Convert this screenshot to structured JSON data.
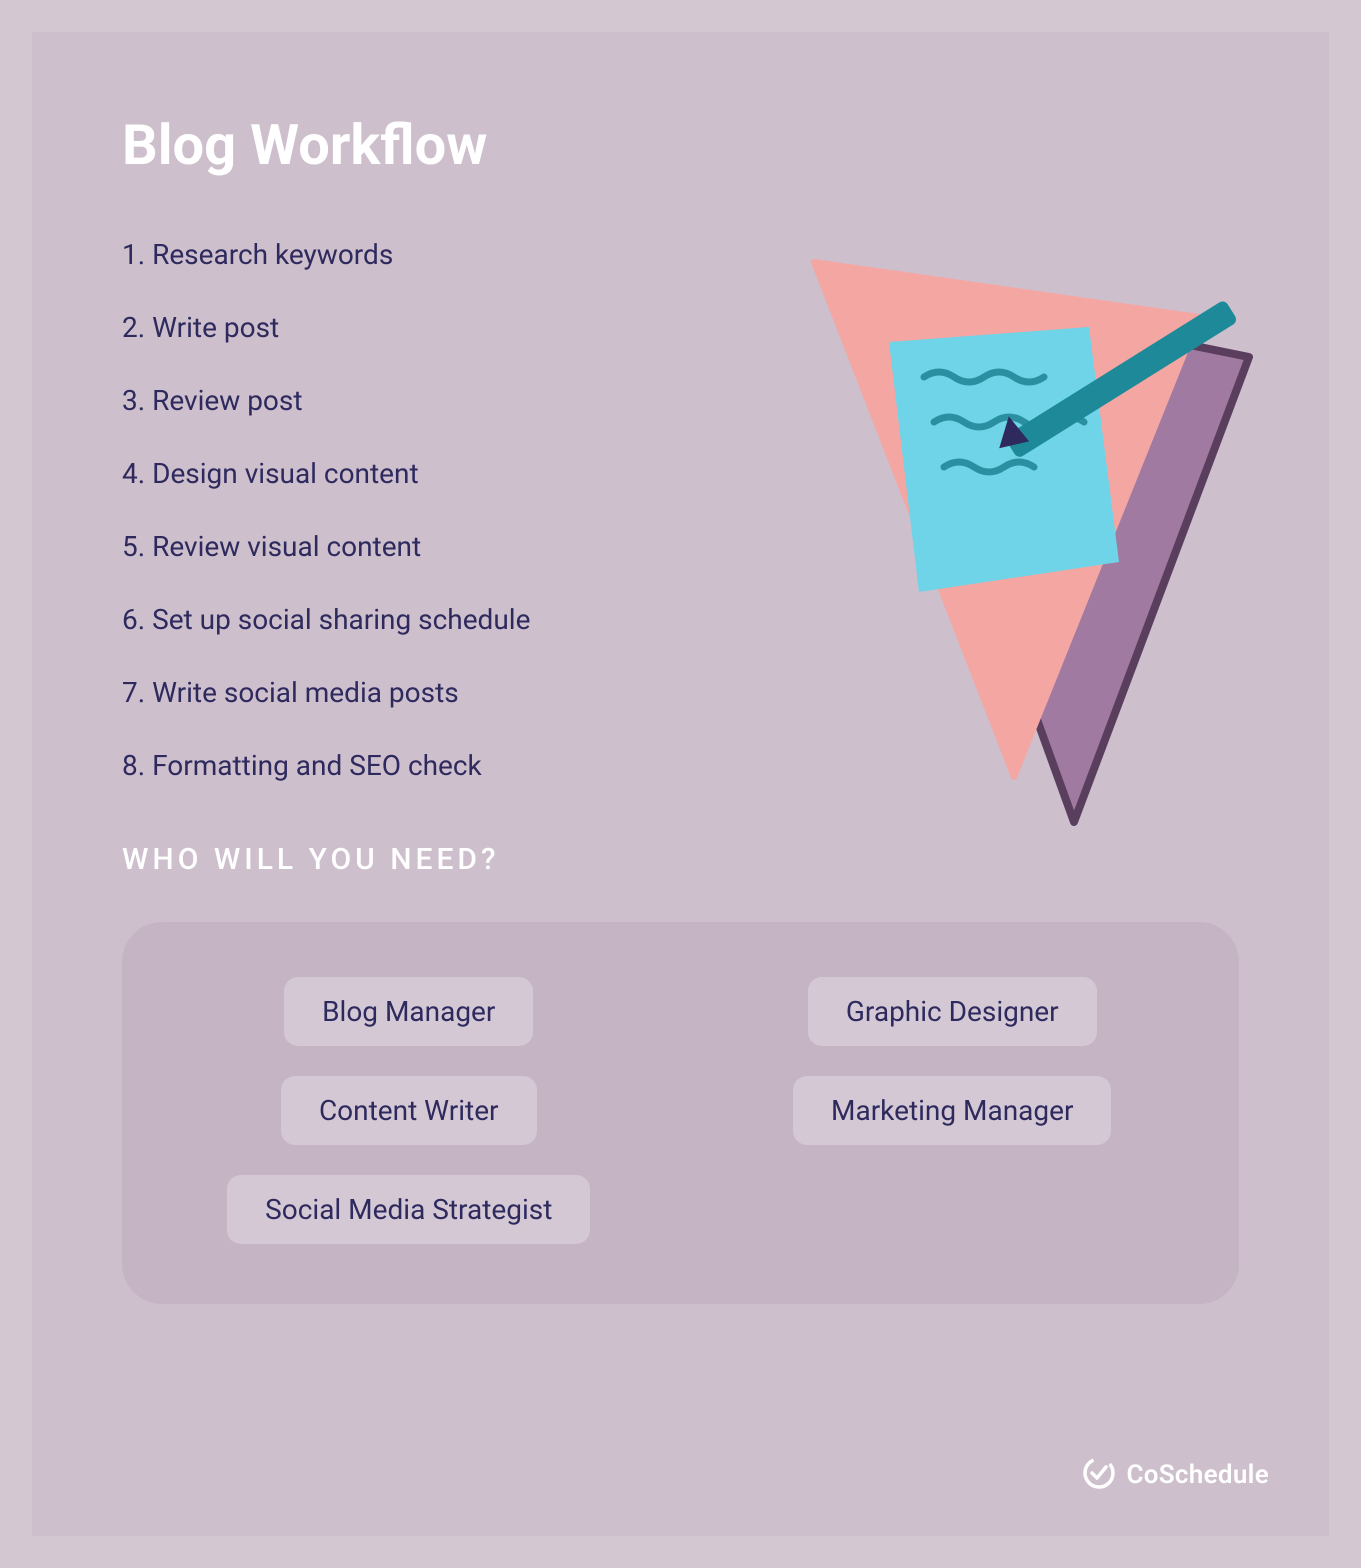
{
  "title": "Blog Workflow",
  "steps": [
    "Research keywords",
    "Write post",
    "Review post",
    "Design visual content",
    "Review visual content",
    "Set up social sharing schedule",
    "Write social media posts",
    "Formatting and SEO check"
  ],
  "who_heading": "WHO WILL YOU NEED?",
  "roles": [
    "Blog Manager",
    "Graphic Designer",
    "Content Writer",
    "Marketing Manager",
    "Social Media Strategist"
  ],
  "brand": "CoSchedule",
  "illustration_name": "paper-and-pencil-icon",
  "colors": {
    "outer_bg": "#d3c7d2",
    "inner_bg": "#cdbfcc",
    "panel_bg": "#c5b5c4",
    "pill_bg": "#d4c8d4",
    "text_dark": "#2e2a5e",
    "text_light": "#ffffff"
  }
}
